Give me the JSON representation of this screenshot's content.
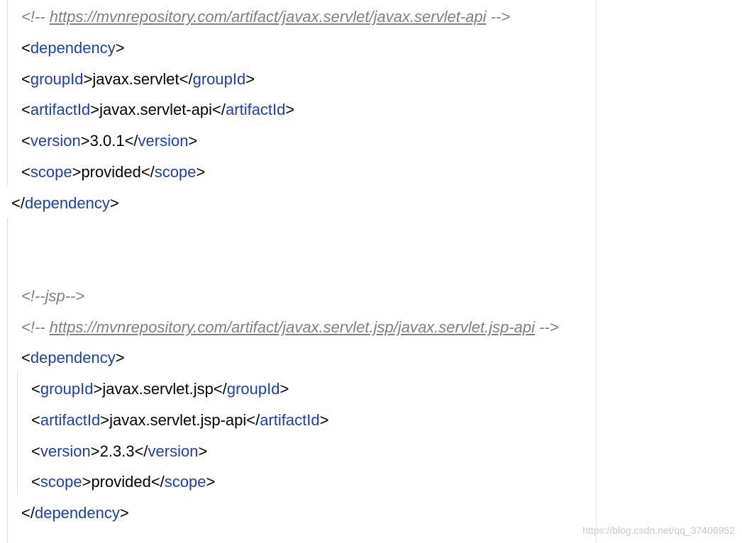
{
  "code_block": {
    "lines": [
      {
        "kind": "comment_url",
        "open": "<!-- ",
        "url": "https://mvnrepository.com/artifact/javax.servlet/javax.servlet-api",
        "close": " -->"
      },
      {
        "kind": "open_tag",
        "tag": "dependency"
      },
      {
        "kind": "element",
        "tag": "groupId",
        "value": "javax.servlet"
      },
      {
        "kind": "element",
        "tag": "artifactId",
        "value": "javax.servlet-api"
      },
      {
        "kind": "element",
        "tag": "version",
        "value": "3.0.1"
      },
      {
        "kind": "element",
        "tag": "scope",
        "value": "provided"
      },
      {
        "kind": "close_tag",
        "tag": "dependency"
      },
      {
        "kind": "comment",
        "text": "<!--jsp-->"
      },
      {
        "kind": "comment_url",
        "open": "<!-- ",
        "url": "https://mvnrepository.com/artifact/javax.servlet.jsp/javax.servlet.jsp-api",
        "close": " -->"
      },
      {
        "kind": "open_tag",
        "tag": "dependency"
      },
      {
        "kind": "element",
        "tag": "groupId",
        "value": "javax.servlet.jsp"
      },
      {
        "kind": "element",
        "tag": "artifactId",
        "value": "javax.servlet.jsp-api"
      },
      {
        "kind": "element",
        "tag": "version",
        "value": "2.3.3"
      },
      {
        "kind": "element",
        "tag": "scope",
        "value": "provided"
      },
      {
        "kind": "close_tag",
        "tag": "dependency"
      }
    ]
  },
  "watermark": "https://blog.csdn.net/qq_37406952",
  "colors": {
    "tag": "#1a3fb4",
    "comment": "#808080",
    "text": "#000000",
    "background": "#ffffff"
  }
}
